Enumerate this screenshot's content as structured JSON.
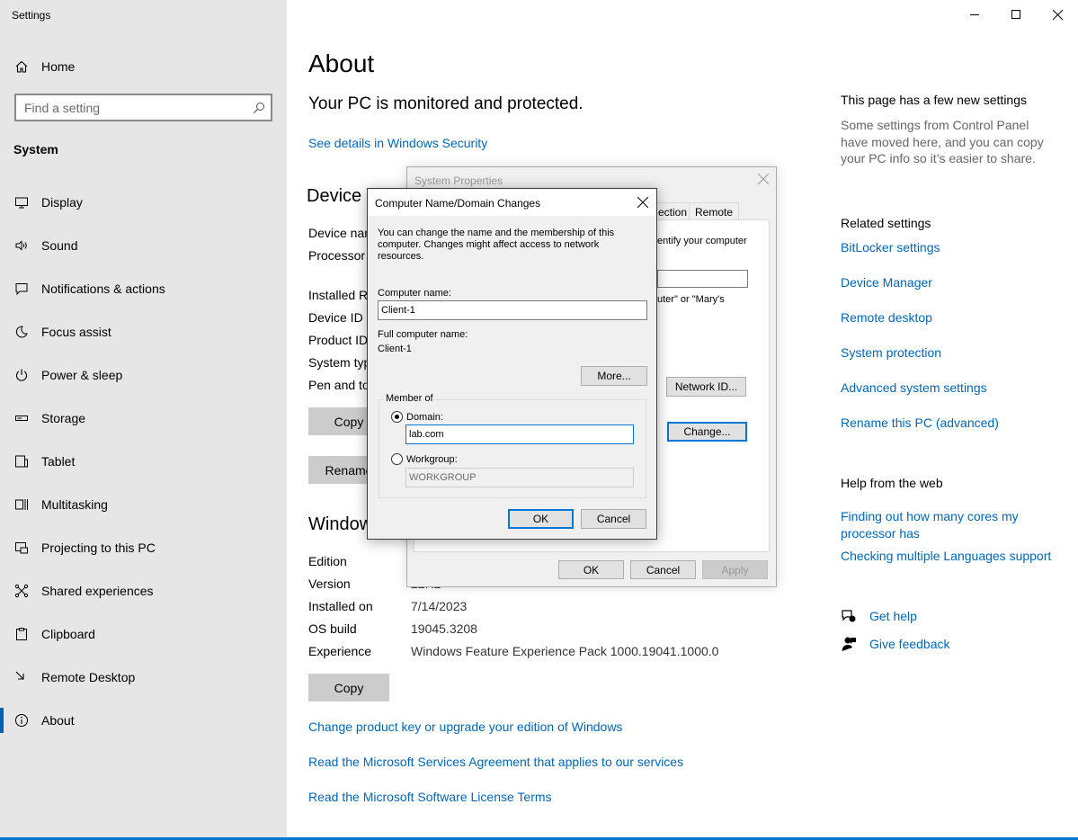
{
  "app": {
    "title": "Settings"
  },
  "sidebar": {
    "home_label": "Home",
    "search_placeholder": "Find a setting",
    "section_label": "System",
    "items": [
      {
        "label": "Display",
        "icon": "monitor-icon"
      },
      {
        "label": "Sound",
        "icon": "speaker-icon"
      },
      {
        "label": "Notifications & actions",
        "icon": "notification-icon"
      },
      {
        "label": "Focus assist",
        "icon": "moon-icon"
      },
      {
        "label": "Power & sleep",
        "icon": "power-icon"
      },
      {
        "label": "Storage",
        "icon": "storage-icon"
      },
      {
        "label": "Tablet",
        "icon": "tablet-icon"
      },
      {
        "label": "Multitasking",
        "icon": "multitasking-icon"
      },
      {
        "label": "Projecting to this PC",
        "icon": "projector-icon"
      },
      {
        "label": "Shared experiences",
        "icon": "share-icon"
      },
      {
        "label": "Clipboard",
        "icon": "clipboard-icon"
      },
      {
        "label": "Remote Desktop",
        "icon": "remote-desktop-icon"
      },
      {
        "label": "About",
        "icon": "info-icon",
        "active": true
      }
    ]
  },
  "main": {
    "title": "About",
    "protection_message": "Your PC is monitored and protected.",
    "security_link": "See details in Windows Security",
    "device_specs": {
      "heading": "Device s",
      "rows": [
        {
          "label": "Device nan"
        },
        {
          "label": "Processor"
        },
        {
          "label": "Installed R"
        },
        {
          "label": "Device ID"
        },
        {
          "label": "Product ID"
        },
        {
          "label": "System typ"
        },
        {
          "label": "Pen and to"
        }
      ],
      "copy_button": "Copy",
      "rename_button": "Rename"
    },
    "windows_specs": {
      "heading": "Window",
      "rows": [
        {
          "label": "Edition",
          "value": ""
        },
        {
          "label": "Version",
          "value": "22H2"
        },
        {
          "label": "Installed on",
          "value": "7/14/2023"
        },
        {
          "label": "OS build",
          "value": "19045.3208"
        },
        {
          "label": "Experience",
          "value": "Windows Feature Experience Pack 1000.19041.1000.0"
        }
      ],
      "copy_button": "Copy"
    },
    "links": [
      "Change product key or upgrade your edition of Windows",
      "Read the Microsoft Services Agreement that applies to our services",
      "Read the Microsoft Software License Terms"
    ]
  },
  "right": {
    "new_settings_title": "This page has a few new settings",
    "new_settings_desc": "Some settings from Control Panel have moved here, and you can copy your PC info so it’s easier to share.",
    "related_title": "Related settings",
    "related_links": [
      "BitLocker settings",
      "Device Manager",
      "Remote desktop",
      "System protection",
      "Advanced system settings",
      "Rename this PC (advanced)"
    ],
    "help_title": "Help from the web",
    "help_links": [
      "Finding out how many cores my processor has",
      "Checking multiple Languages support"
    ],
    "get_help": "Get help",
    "give_feedback": "Give feedback"
  },
  "system_properties": {
    "title": "System Properties",
    "tab_partial": "ection",
    "tab_remote": "Remote",
    "text_identify": "entify your computer",
    "text_example": "uter\" or \"Mary's",
    "network_id_button": "Network ID...",
    "change_button": "Change...",
    "ok": "OK",
    "cancel": "Cancel",
    "apply": "Apply"
  },
  "computer_name_dialog": {
    "title": "Computer Name/Domain Changes",
    "description": "You can change the name and the membership of this computer. Changes might affect access to network resources.",
    "computer_name_label": "Computer name:",
    "computer_name_value": "Client-1",
    "full_name_label": "Full computer name:",
    "full_name_value": "Client-1",
    "more_button": "More...",
    "member_of_label": "Member of",
    "domain_label": "Domain:",
    "domain_value": "lab.com",
    "workgroup_label": "Workgroup:",
    "workgroup_value": "WORKGROUP",
    "ok": "OK",
    "cancel": "Cancel"
  }
}
